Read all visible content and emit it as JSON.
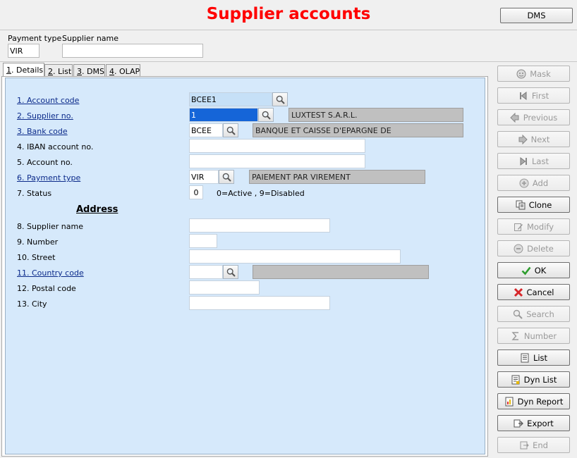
{
  "window": {
    "title": "Supplier accounts",
    "dms_button": "DMS"
  },
  "filter": {
    "payment_type_label": "Payment type",
    "payment_type_value": "VIR",
    "supplier_name_label": "Supplier name",
    "supplier_name_value": ""
  },
  "tabs": [
    {
      "key": "1",
      "label": ". Details",
      "selected": true
    },
    {
      "key": "2",
      "label": ". List",
      "selected": false
    },
    {
      "key": "3",
      "label": ". DMS",
      "selected": false
    },
    {
      "key": "4",
      "label": ". OLAP",
      "selected": false
    }
  ],
  "form": {
    "account_code": {
      "label": "1. Account code",
      "value": "BCEE1"
    },
    "supplier_no": {
      "label": "2. Supplier no.",
      "value": "1",
      "description": "LUXTEST S.A.R.L."
    },
    "bank_code": {
      "label": "3. Bank code",
      "value": "BCEE",
      "description": "BANQUE ET CAISSE D'EPARGNE DE"
    },
    "iban": {
      "label": "4. IBAN account no.",
      "value": ""
    },
    "account_no": {
      "label": "5. Account no.",
      "value": ""
    },
    "payment_type": {
      "label": "6. Payment type",
      "value": "VIR",
      "description": "PAIEMENT PAR VIREMENT"
    },
    "status": {
      "label": "7. Status",
      "value": "0",
      "hint": "0=Active , 9=Disabled"
    },
    "address_heading": "Address",
    "supplier_name": {
      "label": "8. Supplier name",
      "value": ""
    },
    "number": {
      "label": "9. Number",
      "value": ""
    },
    "street": {
      "label": "10. Street",
      "value": ""
    },
    "country_code": {
      "label": "11. Country code",
      "value": "",
      "description": ""
    },
    "postal_code": {
      "label": "12. Postal code",
      "value": ""
    },
    "city": {
      "label": "13. City",
      "value": ""
    }
  },
  "actions": [
    {
      "label": "Mask",
      "icon": "mask-icon",
      "enabled": false
    },
    {
      "label": "First",
      "icon": "first-icon",
      "enabled": false
    },
    {
      "label": "Previous",
      "icon": "previous-icon",
      "enabled": false
    },
    {
      "label": "Next",
      "icon": "next-icon",
      "enabled": false
    },
    {
      "label": "Last",
      "icon": "last-icon",
      "enabled": false
    },
    {
      "label": "Add",
      "icon": "add-icon",
      "enabled": false
    },
    {
      "label": "Clone",
      "icon": "clone-icon",
      "enabled": true
    },
    {
      "label": "Modify",
      "icon": "modify-icon",
      "enabled": false
    },
    {
      "label": "Delete",
      "icon": "delete-icon",
      "enabled": false
    },
    {
      "label": "OK",
      "icon": "check-icon",
      "enabled": true
    },
    {
      "label": "Cancel",
      "icon": "cancel-icon",
      "enabled": true
    },
    {
      "label": "Search",
      "icon": "search-icon",
      "enabled": false
    },
    {
      "label": "Number",
      "icon": "sigma-icon",
      "enabled": false
    },
    {
      "label": "List",
      "icon": "list-icon",
      "enabled": true
    },
    {
      "label": "Dyn List",
      "icon": "dyn-list-icon",
      "enabled": true
    },
    {
      "label": "Dyn Report",
      "icon": "report-icon",
      "enabled": true
    },
    {
      "label": "Export",
      "icon": "export-icon",
      "enabled": true
    },
    {
      "label": "End",
      "icon": "end-icon",
      "enabled": false
    }
  ],
  "colors": {
    "title": "#ff0000",
    "panel": "#d6e9fb",
    "link": "#0b2a8a",
    "ok_icon": "#2e9d2e",
    "cancel_icon": "#d6262a"
  }
}
